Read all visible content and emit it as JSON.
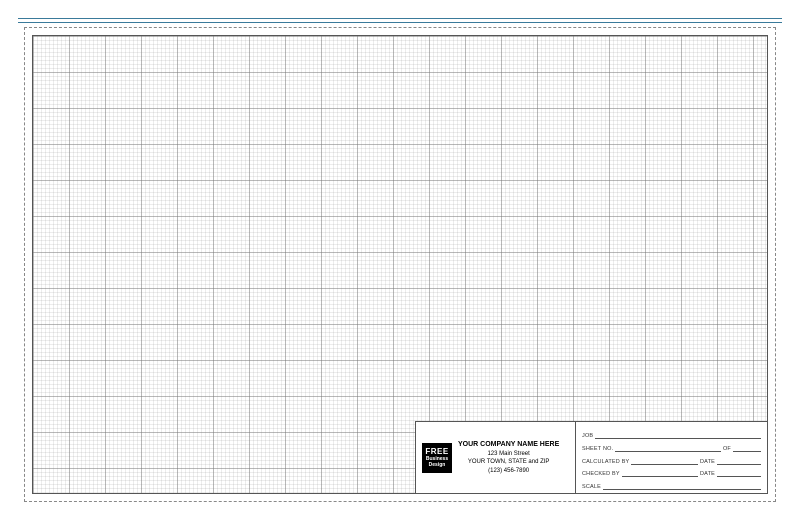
{
  "badge": {
    "line1": "FREE",
    "line2": "Business",
    "line3": "Design"
  },
  "company": {
    "name": "YOUR COMPANY NAME HERE",
    "street": "123 Main Street",
    "citystate": "YOUR TOWN, STATE and ZIP",
    "phone": "(123) 456-7890"
  },
  "fields": {
    "job": "JOB",
    "sheet_no": "SHEET NO.",
    "of": "OF",
    "calculated_by": "CALCULATED BY",
    "date": "DATE",
    "checked_by": "CHECKED BY",
    "scale": "SCALE"
  }
}
